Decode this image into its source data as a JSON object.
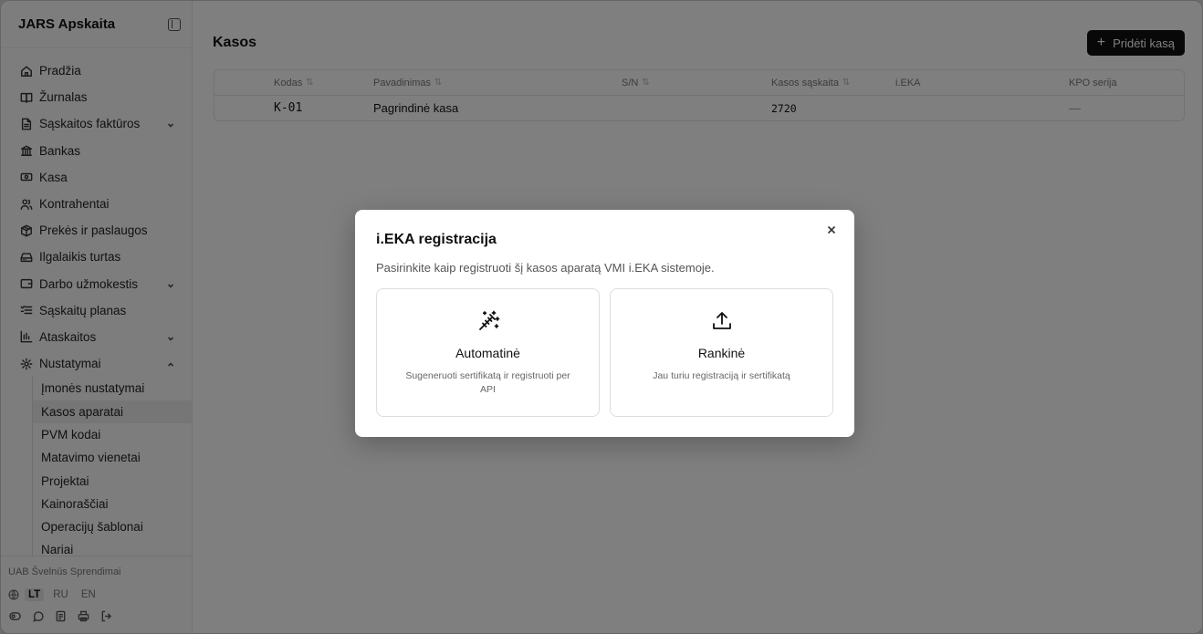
{
  "sidebar": {
    "brand": "JARS Apskaita",
    "items": [
      {
        "label": "Pradžia",
        "icon": "home-icon"
      },
      {
        "label": "Žurnalas",
        "icon": "book-icon"
      },
      {
        "label": "Sąskaitos faktūros",
        "icon": "file-icon",
        "expand": "down"
      },
      {
        "label": "Bankas",
        "icon": "bank-icon"
      },
      {
        "label": "Kasa",
        "icon": "cash-icon"
      },
      {
        "label": "Kontrahentai",
        "icon": "users-icon"
      },
      {
        "label": "Prekės ir paslaugos",
        "icon": "package-icon"
      },
      {
        "label": "Ilgalaikis turtas",
        "icon": "hard-drive-icon"
      },
      {
        "label": "Darbo užmokestis",
        "icon": "wallet-icon",
        "expand": "down"
      },
      {
        "label": "Sąskaitų planas",
        "icon": "list-icon"
      },
      {
        "label": "Ataskaitos",
        "icon": "chart-icon",
        "expand": "down"
      },
      {
        "label": "Nustatymai",
        "icon": "gear-icon",
        "expand": "up"
      }
    ],
    "sub_items": [
      {
        "label": "Įmonės nustatymai"
      },
      {
        "label": "Kasos aparatai",
        "active": true
      },
      {
        "label": "PVM kodai"
      },
      {
        "label": "Matavimo vienetai"
      },
      {
        "label": "Projektai"
      },
      {
        "label": "Kainoraščiai"
      },
      {
        "label": "Operacijų šablonai"
      },
      {
        "label": "Nariai"
      }
    ],
    "company": "UAB Švelnūs Sprendimai",
    "languages": [
      "LT",
      "RU",
      "EN"
    ],
    "active_language": "LT"
  },
  "main": {
    "title": "Kasos",
    "add_button": "Pridėti kasą",
    "table": {
      "columns": [
        "Kodas",
        "Pavadinimas",
        "S/N",
        "Kasos sąskaita",
        "i.EKA",
        "KPO serija"
      ],
      "rows": [
        [
          "K-01",
          "Pagrindinė kasa",
          "",
          "2720",
          "",
          "—"
        ]
      ]
    }
  },
  "modal": {
    "title": "i.EKA registracija",
    "description": "Pasirinkite kaip registruoti šį kasos aparatą VMI i.EKA sistemoje.",
    "options": [
      {
        "title": "Automatinė",
        "description": "Sugeneruoti sertifikatą ir registruoti per API",
        "icon": "magic-wand-icon"
      },
      {
        "title": "Rankinė",
        "description": "Jau turiu registraciją ir sertifikatą",
        "icon": "upload-icon"
      }
    ]
  }
}
